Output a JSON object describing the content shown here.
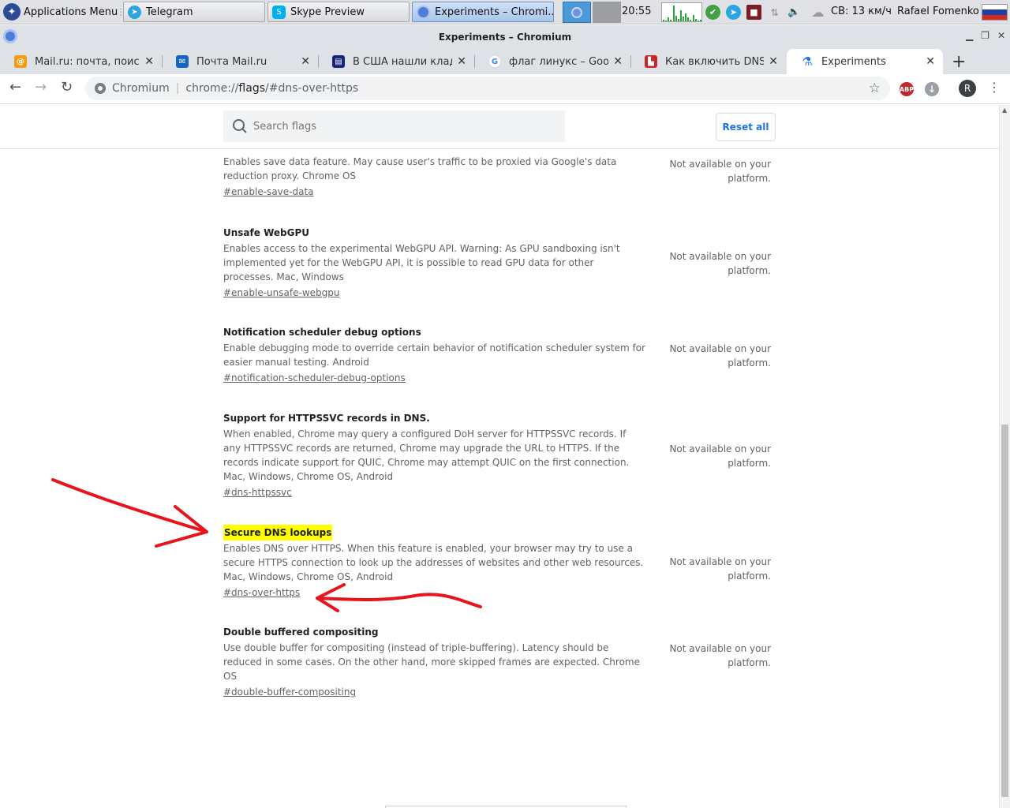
{
  "panel": {
    "apps_menu": "Applications Menu",
    "tasks": [
      {
        "label": "Telegram"
      },
      {
        "label": "Skype Preview"
      },
      {
        "label": "Experiments – Chromi..."
      }
    ],
    "clock": "20:55",
    "cpu_levels": [
      0.1,
      0.05,
      0.2,
      0.1,
      0.85,
      0.3,
      0.15,
      0.6,
      0.25,
      0.45,
      0.2,
      0.1,
      0.35,
      0.15,
      0.05,
      0.1
    ],
    "weather": "СВ: 13 км/ч",
    "user": "Rafael Fomenko"
  },
  "window": {
    "title": "Experiments – Chromium"
  },
  "tabs": [
    {
      "title": "Mail.ru: почта, поиск в",
      "favicon": "mailru-icon",
      "color": "#f39c12",
      "glyph": "@"
    },
    {
      "title": "Почта Mail.ru",
      "favicon": "mail-envelope-icon",
      "color": "#1565c0",
      "glyph": "✉"
    },
    {
      "title": "В США нашли клад на",
      "favicon": "news-icon",
      "color": "#1a237e",
      "glyph": "▤"
    },
    {
      "title": "флаг линукс – Google",
      "favicon": "google-icon",
      "color": "#ffffff",
      "glyph": "G"
    },
    {
      "title": "Как включить DNS-ove",
      "favicon": "site-icon",
      "color": "#c62828",
      "glyph": "▙"
    },
    {
      "title": "Experiments",
      "favicon": "flask-icon",
      "color": "#1a73e8",
      "glyph": "⚗"
    }
  ],
  "toolbar": {
    "site_label": "Chromium",
    "url_prefix": "chrome://",
    "url_domain": "flags",
    "url_suffix": "/#dns-over-https",
    "abp": "ABP",
    "avatar": "R"
  },
  "flags_page": {
    "search_placeholder": "Search flags",
    "reset_all": "Reset all",
    "experiments": [
      {
        "title": "Enables save data feature",
        "description": "Enables save data feature. May cause user's traffic to be proxied via Google's data reduction proxy. Chrome OS",
        "link": "#enable-save-data",
        "status": "Not available on your platform.",
        "highlighted": false
      },
      {
        "title": "Unsafe WebGPU",
        "description": "Enables access to the experimental WebGPU API. Warning: As GPU sandboxing isn't implemented yet for the WebGPU API, it is possible to read GPU data for other processes. Mac, Windows",
        "link": "#enable-unsafe-webgpu",
        "status": "Not available on your platform.",
        "highlighted": false
      },
      {
        "title": "Notification scheduler debug options",
        "description": "Enable debugging mode to override certain behavior of notification scheduler system for easier manual testing. Android",
        "link": "#notification-scheduler-debug-options",
        "status": "Not available on your platform.",
        "highlighted": false
      },
      {
        "title": "Support for HTTPSSVC records in DNS.",
        "description": "When enabled, Chrome may query a configured DoH server for HTTPSSVC records. If any HTTPSSVC records are returned, Chrome may upgrade the URL to HTTPS. If the records indicate support for QUIC, Chrome may attempt QUIC on the first connection. Mac, Windows, Chrome OS, Android",
        "link": "#dns-httpssvc",
        "status": "Not available on your platform.",
        "highlighted": false
      },
      {
        "title": "Secure DNS lookups",
        "description": "Enables DNS over HTTPS. When this feature is enabled, your browser may try to use a secure HTTPS connection to look up the addresses of websites and other web resources. Mac, Windows, Chrome OS, Android",
        "link": "#dns-over-https",
        "status": "Not available on your platform.",
        "highlighted": true
      },
      {
        "title": "Double buffered compositing",
        "description": "Use double buffer for compositing (instead of triple-buffering). Latency should be reduced in some cases. On the other hand, more skipped frames are expected. Chrome OS",
        "link": "#double-buffer-compositing",
        "status": "Not available on your platform.",
        "highlighted": false
      }
    ]
  },
  "colors": {
    "annotation_arrow": "#e8141b",
    "highlight": "#ffff00",
    "accent": "#1a73e8"
  }
}
